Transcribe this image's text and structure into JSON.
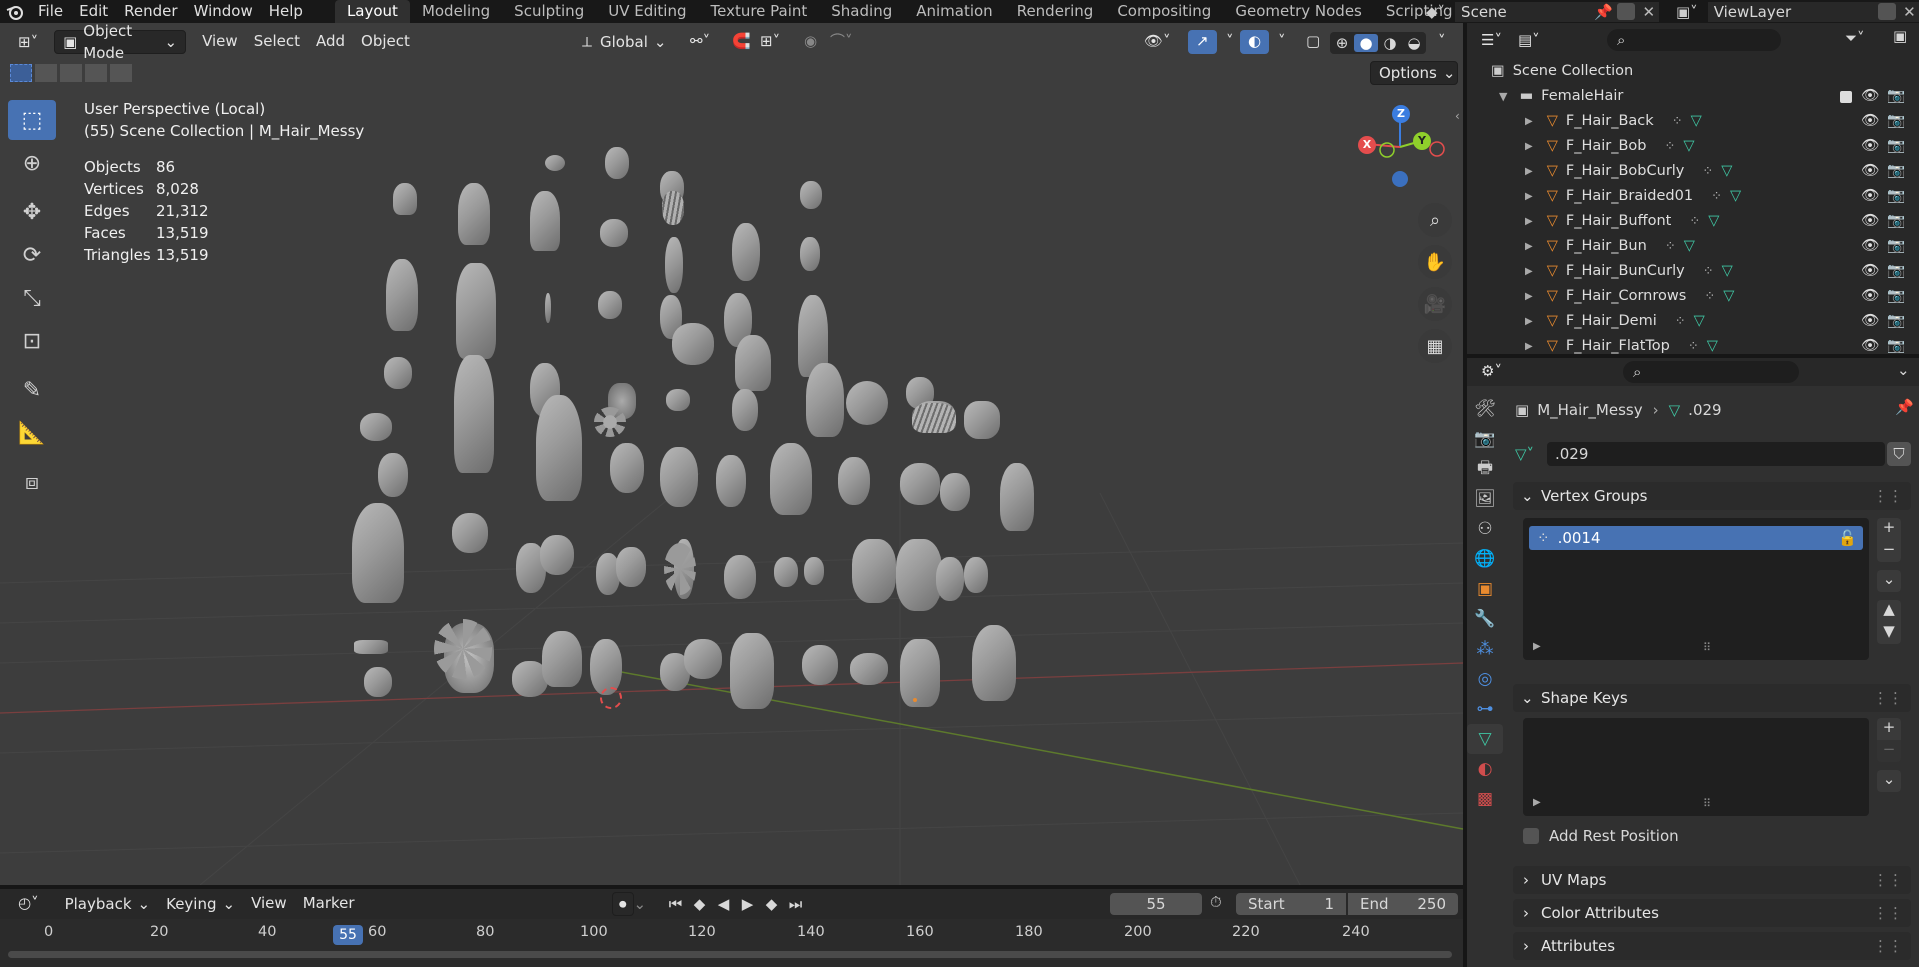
{
  "topbar": {
    "menus": [
      "File",
      "Edit",
      "Render",
      "Window",
      "Help"
    ],
    "workspaces": [
      "Layout",
      "Modeling",
      "Sculpting",
      "UV Editing",
      "Texture Paint",
      "Shading",
      "Animation",
      "Rendering",
      "Compositing",
      "Geometry Nodes",
      "Scripting"
    ],
    "active_workspace": "Layout",
    "add_workspace": "+",
    "scene_label": "Scene",
    "viewlayer_label": "ViewLayer"
  },
  "viewport": {
    "mode": "Object Mode",
    "menus": [
      "View",
      "Select",
      "Add",
      "Object"
    ],
    "transform_orientation": "Global",
    "options_label": "Options",
    "overlay_title": "User Perspective (Local)",
    "overlay_subtitle": "(55) Scene Collection | M_Hair_Messy",
    "stats": [
      {
        "label": "Objects",
        "value": "86"
      },
      {
        "label": "Vertices",
        "value": "8,028"
      },
      {
        "label": "Edges",
        "value": "21,312"
      },
      {
        "label": "Faces",
        "value": "13,519"
      },
      {
        "label": "Triangles",
        "value": "13,519"
      }
    ],
    "gizmo": {
      "z": "Z",
      "y": "Y",
      "x": "X"
    }
  },
  "outliner": {
    "root": "Scene Collection",
    "collection": "FemaleHair",
    "items": [
      "F_Hair_Back",
      "F_Hair_Bob",
      "F_Hair_BobCurly",
      "F_Hair_Braided01",
      "F_Hair_Buffont",
      "F_Hair_Bun",
      "F_Hair_BunCurly",
      "F_Hair_Cornrows",
      "F_Hair_Demi",
      "F_Hair_FlatTop"
    ]
  },
  "properties": {
    "breadcrumb_object": "M_Hair_Messy",
    "breadcrumb_data": ".029",
    "datablock_name": ".029",
    "vertex_groups_title": "Vertex Groups",
    "vertex_group_item": ".0014",
    "shape_keys_title": "Shape Keys",
    "add_rest_position": "Add Rest Position",
    "uv_maps_title": "UV Maps",
    "color_attributes_title": "Color Attributes",
    "attributes_title": "Attributes"
  },
  "timeline": {
    "menus": [
      "Playback",
      "Keying",
      "View",
      "Marker"
    ],
    "current_frame": "55",
    "start_label": "Start",
    "start_value": "1",
    "end_label": "End",
    "end_value": "250",
    "ticks": [
      "0",
      "20",
      "40",
      "60",
      "80",
      "100",
      "120",
      "140",
      "160",
      "180",
      "200",
      "220",
      "240"
    ]
  },
  "colors": {
    "accent": "#4772b3",
    "viewport_bg": "#3d3d3d",
    "object_orange": "#e88a2f",
    "mesh_green": "#3fc6a3",
    "axis_x": "#e44d4d",
    "axis_y": "#8fcf2b",
    "axis_z": "#3b7de0"
  }
}
